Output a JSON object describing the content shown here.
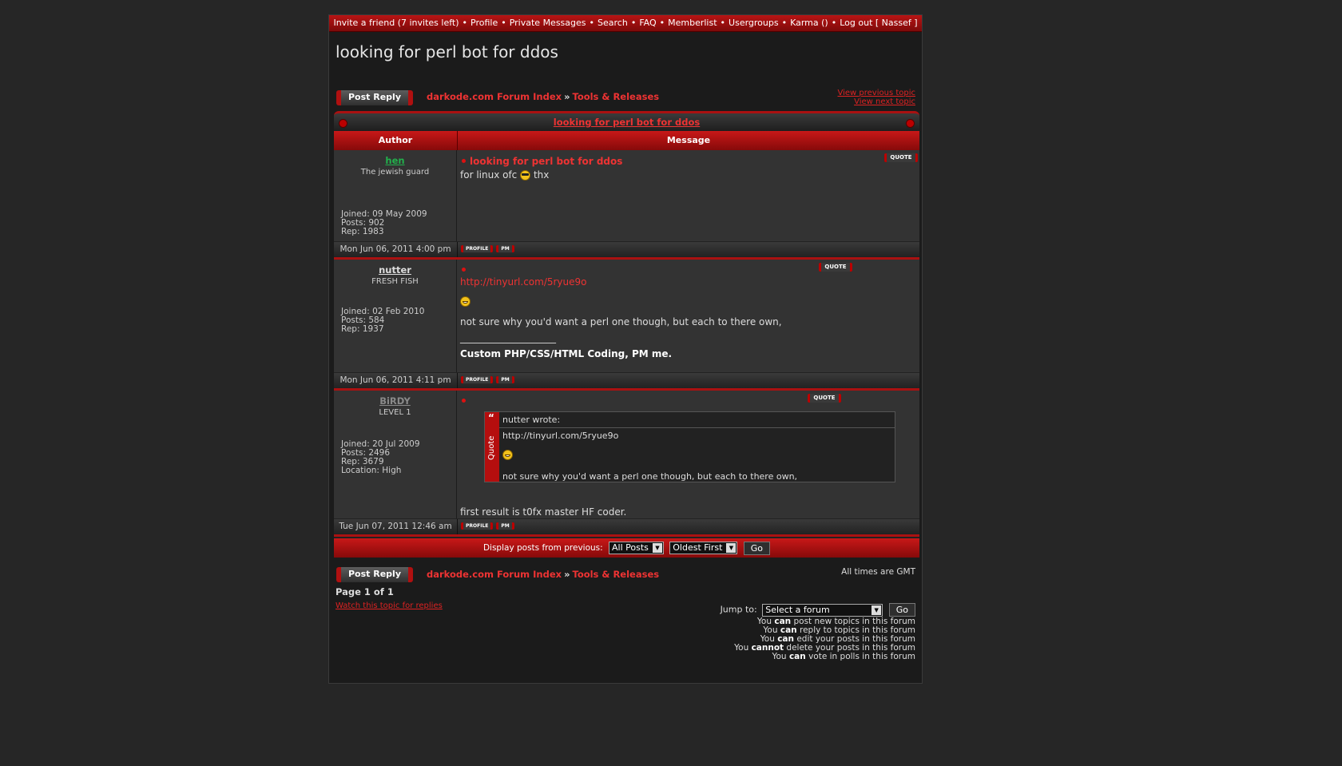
{
  "nav": {
    "items": [
      "Invite a friend (7 invites left)",
      "Profile",
      "Private Messages",
      "Search",
      "FAQ",
      "Memberlist",
      "Usergroups",
      "Karma ()",
      "Log out [ Nassef ]"
    ],
    "separator": "•"
  },
  "topic_title": "looking for perl bot for ddos",
  "post_reply_label": "Post Reply",
  "breadcrumb": {
    "index": "darkode.com Forum Index",
    "arrow": "»",
    "forum": "Tools & Releases"
  },
  "view_previous": "View previous topic",
  "view_next": "View next topic",
  "table_header_link": "looking for perl bot for ddos",
  "columns": {
    "author": "Author",
    "message": "Message"
  },
  "quote_label": "QUOTE",
  "profile_label": "PROFILE",
  "pm_label": "PM",
  "posts": [
    {
      "username": "hen",
      "username_color": "#22b14c",
      "rank": "The jewish guard",
      "joined": "Joined: 09 May 2009",
      "posts": "Posts: 902",
      "rep": "Rep: 1983",
      "location": "",
      "subject": "looking for perl bot for ddos",
      "body_before": "for linux ofc",
      "body_after": "thx",
      "date": "Mon Jun 06, 2011 4:00 pm"
    },
    {
      "username": "nutter",
      "username_color": "#dddddd",
      "rank": "FRESH FISH",
      "joined": "Joined: 02 Feb 2010",
      "posts": "Posts: 584",
      "rep": "Rep: 1937",
      "location": "",
      "link": "http://tinyurl.com/5ryue9o",
      "body": "not sure why you'd want a perl one though, but each to there own,",
      "signature_line": "____________________",
      "signature": "Custom PHP/CSS/HTML Coding, PM me.",
      "date": "Mon Jun 06, 2011 4:11 pm"
    },
    {
      "username": "BiRDY",
      "username_color": "#8a8a8a",
      "rank": "LEVEL 1",
      "joined": "Joined: 20 Jul 2009",
      "posts": "Posts: 2496",
      "rep": "Rep: 3679",
      "location": "Location: High",
      "quote_label": "Quote",
      "quote_mark": "“",
      "quote_author": "nutter wrote:",
      "quote_link": "http://tinyurl.com/5ryue9o",
      "quote_body": "not sure why you'd want a perl one though, but each to there own,",
      "body": "first result is t0fx master HF coder.",
      "date": "Tue Jun 07, 2011 12:46 am"
    }
  ],
  "display": {
    "label": "Display posts from previous:",
    "posts_value": "All Posts",
    "order_value": "Oldest First",
    "go": "Go"
  },
  "timezone": "All times are GMT",
  "page_info": "Page 1 of 1",
  "watch_topic": "Watch this topic for replies",
  "jump": {
    "label": "Jump to:",
    "value": "Select a forum",
    "go": "Go"
  },
  "permissions": [
    {
      "pre": "You",
      "bold": "can",
      "post": "post new topics in this forum"
    },
    {
      "pre": "You",
      "bold": "can",
      "post": "reply to topics in this forum"
    },
    {
      "pre": "You",
      "bold": "can",
      "post": "edit your posts in this forum"
    },
    {
      "pre": "You",
      "bold": "cannot",
      "post": "delete your posts in this forum"
    },
    {
      "pre": "You",
      "bold": "can",
      "post": "vote in polls in this forum"
    }
  ]
}
